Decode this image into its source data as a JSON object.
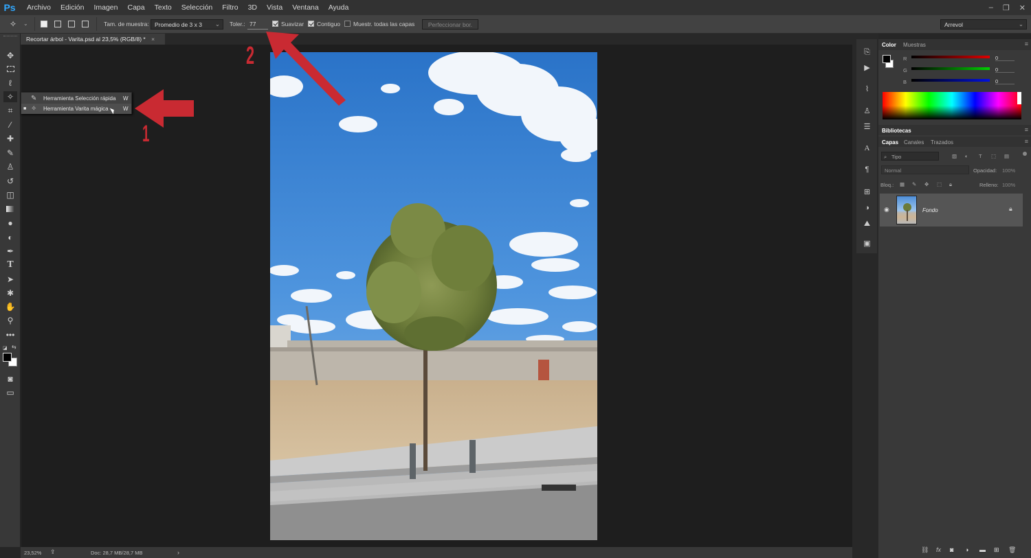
{
  "app": {
    "logo": "Ps"
  },
  "menu": [
    "Archivo",
    "Edición",
    "Imagen",
    "Capa",
    "Texto",
    "Selección",
    "Filtro",
    "3D",
    "Vista",
    "Ventana",
    "Ayuda"
  ],
  "options": {
    "sample_size_label": "Tam. de muestra:",
    "sample_size_value": "Promedio de 3 x 3",
    "tolerance_label": "Toler.:",
    "tolerance_value": "77",
    "antialias_label": "Suavizar",
    "antialias_checked": true,
    "contiguous_label": "Contiguo",
    "contiguous_checked": true,
    "sample_all_label": "Muestr. todas las capas",
    "sample_all_checked": false,
    "refine_label": "Perfeccionar bor.",
    "workspace": "Arrevol"
  },
  "document": {
    "tab_title": "Recortar árbol - Varita.psd al 23,5% (RGB/8) *",
    "close": "×"
  },
  "flyout": {
    "items": [
      {
        "label": "Herramienta Selección rápida",
        "shortcut": "W"
      },
      {
        "label": "Herramienta Varita mágica",
        "shortcut": "W"
      }
    ]
  },
  "annotations": {
    "one": "1",
    "two": "2"
  },
  "status": {
    "zoom": "23,52%",
    "doc": "Doc: 28,7 MB/28,7 MB",
    "arrow": "›"
  },
  "color_panel": {
    "tabs": [
      "Color",
      "Muestras"
    ],
    "channels": [
      {
        "label": "R",
        "value": "0"
      },
      {
        "label": "G",
        "value": "0"
      },
      {
        "label": "B",
        "value": "0"
      }
    ]
  },
  "libraries": {
    "title": "Bibliotecas"
  },
  "layers_panel": {
    "tabs": [
      "Capas",
      "Canales",
      "Trazados"
    ],
    "filter_placeholder": "Tipo",
    "blend_mode": "Normal",
    "opacity_label": "Opacidad:",
    "opacity_value": "100%",
    "lock_label": "Bloq.:",
    "fill_label": "Relleno:",
    "fill_value": "100%",
    "layers": [
      {
        "name": "Fondo"
      }
    ]
  },
  "colors": {
    "accent_red": "#c92a32",
    "ps_blue": "#31a8ff"
  }
}
